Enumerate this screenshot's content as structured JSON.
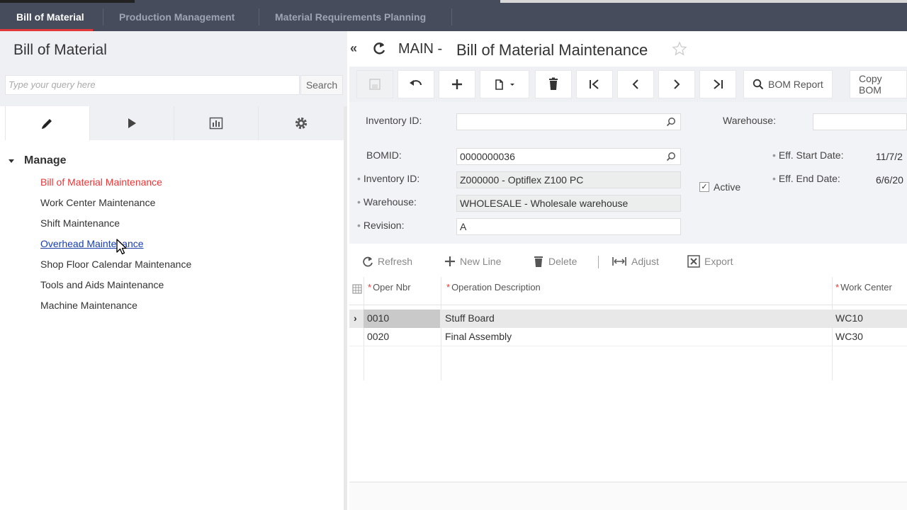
{
  "top_tabs": [
    {
      "label": "Bill of Material"
    },
    {
      "label": "Production Management"
    },
    {
      "label": "Material Requirements Planning"
    }
  ],
  "left": {
    "title": "Bill of Material",
    "search_placeholder": "Type your query here",
    "search_button": "Search",
    "section": "Manage",
    "links": [
      "Bill of Material Maintenance",
      "Work Center Maintenance",
      "Shift Maintenance",
      "Overhead Maintenance",
      "Shop Floor Calendar Maintenance",
      "Tools and Aids Maintenance",
      "Machine Maintenance"
    ]
  },
  "header": {
    "module": "MAIN -",
    "title": "Bill of Material Maintenance"
  },
  "toolbar": {
    "bom_report": "BOM Report",
    "copy_bom": "Copy BOM"
  },
  "form": {
    "inventory_id_label": "Inventory ID:",
    "inventory_id_value": "",
    "warehouse_label": "Warehouse:",
    "warehouse_value": "",
    "bomid_label": "BOMID:",
    "bomid_value": "0000000036",
    "inv_id2_label": "Inventory ID:",
    "inv_id2_value": "Z000000 - Optiflex Z100 PC",
    "warehouse2_label": "Warehouse:",
    "warehouse2_value": "WHOLESALE - Wholesale warehouse",
    "revision_label": "Revision:",
    "revision_value": "A",
    "active_label": "Active",
    "active_checked": true,
    "eff_start_label": "Eff. Start Date:",
    "eff_start_value": "11/7/2",
    "eff_end_label": "Eff. End Date:",
    "eff_end_value": "6/6/20"
  },
  "grid_toolbar": {
    "refresh": "Refresh",
    "new_line": "New Line",
    "delete": "Delete",
    "adjust": "Adjust",
    "export": "Export"
  },
  "grid": {
    "columns": [
      "Oper Nbr",
      "Operation Description",
      "Work Center"
    ],
    "rows": [
      {
        "oper": "0010",
        "desc": "Stuff Board",
        "wc": "WC10"
      },
      {
        "oper": "0020",
        "desc": "Final Assembly",
        "wc": "WC30"
      }
    ]
  },
  "colors": {
    "accent_red": "#e23a3a",
    "topbar_bg": "#464c5c",
    "link_hover": "#1a3fa8"
  }
}
